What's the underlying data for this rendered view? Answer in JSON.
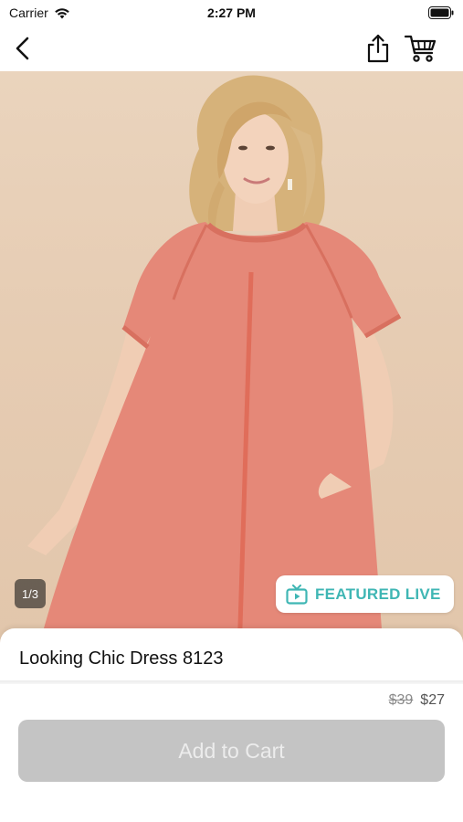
{
  "status_bar": {
    "carrier": "Carrier",
    "time": "2:27 PM",
    "icons": [
      "wifi-icon",
      "battery-icon"
    ]
  },
  "nav": {
    "icons": [
      "back-chevron-icon",
      "share-icon",
      "cart-icon"
    ]
  },
  "gallery": {
    "counter": "1/3",
    "featured_label": "FEATURED LIVE",
    "featured_icon": "tv-play-icon",
    "accent_color": "#3fb6b4"
  },
  "product": {
    "title": "Looking Chic Dress 8123",
    "price_original": "$39",
    "price_sale": "$27"
  },
  "actions": {
    "add_to_cart_label": "Add to Cart",
    "button_color": "#c4c4c4"
  }
}
